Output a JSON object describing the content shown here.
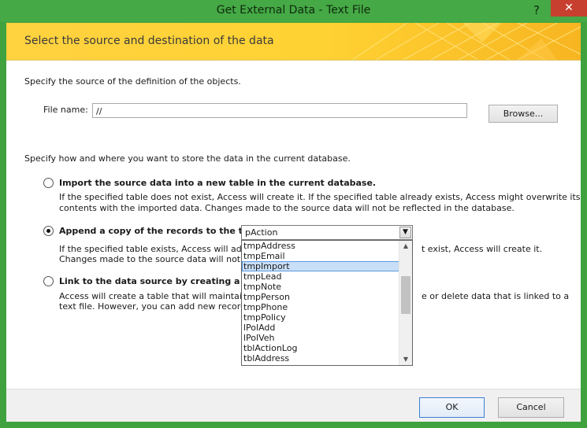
{
  "window": {
    "title": "Get External Data - Text File",
    "help_glyph": "?",
    "close_glyph": "✕"
  },
  "banner": {
    "title": "Select the source and destination of the data"
  },
  "source": {
    "instruction": "Specify the source of the definition of the objects.",
    "file_label": "File name:",
    "file_value": "//",
    "browse_label": "Browse..."
  },
  "storage": {
    "instruction": "Specify how and where you want to store the data in the current database."
  },
  "options": {
    "import": {
      "label": "Import the source data into a new table in the current database.",
      "desc1": "If the specified table does not exist, Access will create it. If the specified table already exists, Access might overwrite its",
      "desc2": "contents with the imported data. Changes made to the source data will not be reflected in the database.",
      "selected": false
    },
    "append": {
      "label": "Append a copy of the records to the table:",
      "combo_value": "pAction",
      "desc1a": "If the specified table exists, Access will add th",
      "desc1b": "t exist, Access will create it.",
      "desc2": "Changes made to the source data will not be",
      "selected": true
    },
    "link": {
      "label": "Link to the data source by creating a linked t",
      "desc1a": "Access will create a table that will maintain a",
      "desc1b": "e or delete data that is linked to a",
      "desc2": "text file. However, you can add new records.",
      "selected": false
    }
  },
  "dropdown": {
    "items": [
      "tmpAddress",
      "tmpEmail",
      "tmpImport",
      "tmpLead",
      "tmpNote",
      "tmpPerson",
      "tmpPhone",
      "tmpPolicy",
      "lPolAdd",
      "lPolVeh",
      "tblActionLog",
      "tblAddress"
    ],
    "highlighted": "tmpImport",
    "scroll_position_fraction": 0.38
  },
  "footer": {
    "ok_label": "OK",
    "cancel_label": "Cancel"
  }
}
